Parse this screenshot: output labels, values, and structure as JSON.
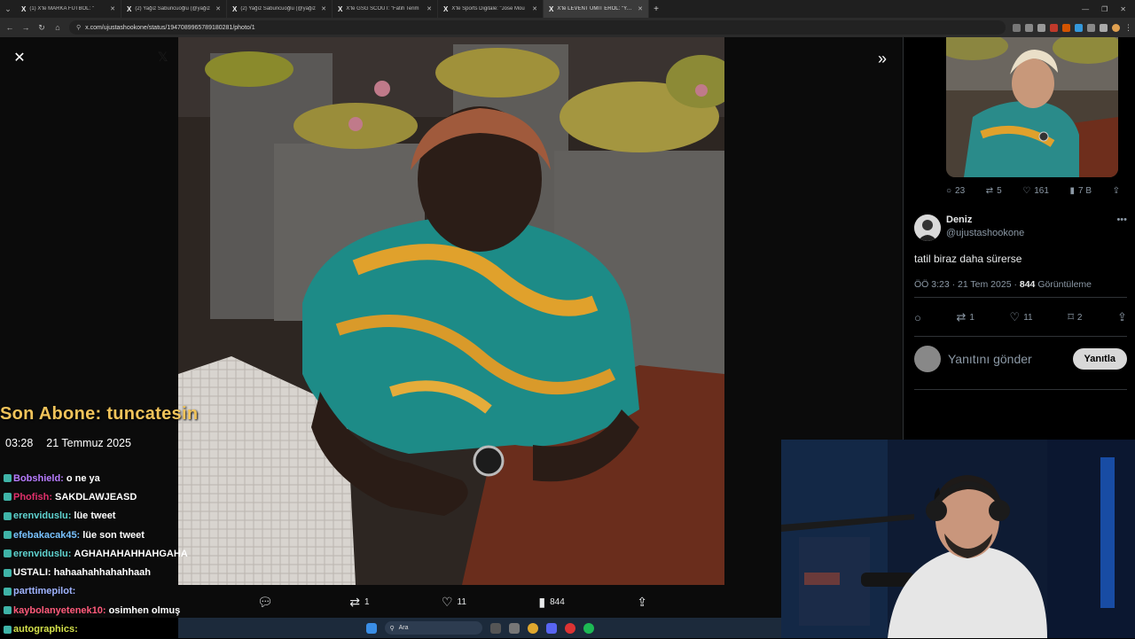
{
  "browser": {
    "tabs": [
      {
        "label": "(1) X'te MARKA FUTBOL: \"",
        "active": false
      },
      {
        "label": "(2) Yağız Sabuncuoğlu (@yağız",
        "active": false
      },
      {
        "label": "(2) Yağız Sabuncuoğlu (@yağız",
        "active": false
      },
      {
        "label": "X'te GSG SCOUT: \"Fatih Terim",
        "active": false
      },
      {
        "label": "X'te Sports Digitale: \"Jose Mou",
        "active": false
      },
      {
        "label": "X'te LEVENT ÜMİT EROL: \"Yerde",
        "active": true
      }
    ],
    "url": "x.com/ujustashookone/status/1947089965789180281/photo/1"
  },
  "viewer": {
    "close_icon": "close-icon",
    "expand_icon": "chevron-double-right-icon",
    "actions": {
      "reply_count": "",
      "retweet_count": "1",
      "like_count": "11",
      "view_count": "844"
    }
  },
  "side": {
    "parent_stats": {
      "replies": "23",
      "retweets": "5",
      "likes": "161",
      "views": "7 B"
    },
    "reply": {
      "name": "Deniz",
      "handle": "@ujustashookone",
      "text": "tatil biraz daha sürerse",
      "time": "ÖÖ 3:23 · 21 Tem 2025 · ",
      "views": "844",
      "views_label": " Görüntüleme",
      "retweets": "1",
      "likes": "11",
      "bookmarks": "2"
    },
    "compose": {
      "placeholder": "Yanıtını gönder",
      "button": "Yanıtla"
    }
  },
  "overlay": {
    "title": "Son Abone: tuncatesin",
    "time": "03:28",
    "date": "21 Temmuz 2025",
    "chat": [
      {
        "user": "Bobshield:",
        "text": "o ne ya",
        "color": "#b77cff"
      },
      {
        "user": "Phofish:",
        "text": "SAKDLAWJEASD",
        "color": "#e0306b"
      },
      {
        "user": "erenviduslu:",
        "text": "lüe tweet",
        "color": "#5fd3d0"
      },
      {
        "user": "efebakacak45:",
        "text": "lüe son tweet",
        "color": "#78c2ff"
      },
      {
        "user": "erenviduslu:",
        "text": "AGHAHAHAHHAHGAHA",
        "color": "#5fd3d0"
      },
      {
        "user": "USTALI:",
        "text": "hahaahahhahahhaah",
        "color": "#ffffff"
      },
      {
        "user": "parttimepilot:",
        "text": "",
        "color": "#9fb3ff"
      },
      {
        "user": "kaybolanyetenek10:",
        "text": "osimhen olmuş",
        "color": "#ff5a7a"
      },
      {
        "user": "autographics:",
        "text": "",
        "color": "#d3e04a"
      }
    ]
  },
  "taskbar": {
    "search": "Ara"
  }
}
